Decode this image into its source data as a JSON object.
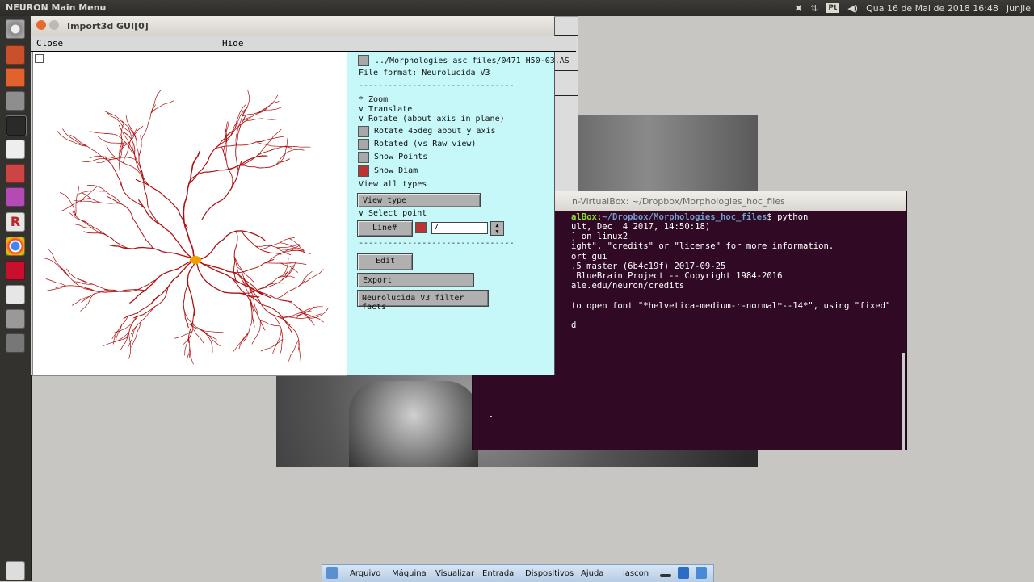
{
  "topbar": {
    "app_name": "NEURON Main Menu",
    "lang": "Pt",
    "clock": "Qua 16 de Mai de 2018 16:48",
    "user": "Junjie"
  },
  "launcher_icons": [
    "dash-icon",
    "files-icon",
    "ubuntu-software-icon",
    "settings-icon",
    "terminal-icon",
    "text-editor-icon",
    "system-monitor-icon",
    "terminal2-icon",
    "r-icon",
    "chrome-icon",
    "mendeley-icon",
    "gedit-icon",
    "disk-icon",
    "drive-icon",
    "trash-icon"
  ],
  "gui_window": {
    "title": "Import3d GUI[0]",
    "menu": {
      "close": "Close",
      "hide": "Hide"
    },
    "panel": {
      "path": "../Morphologies_asc_files/0471_H50-03.AS",
      "file_format": "File format: Neurolucida V3",
      "dashes": "--------------------------------",
      "radio_zoom": "* Zoom",
      "radio_translate": "∨ Translate",
      "radio_rotate": "∨ Rotate (about axis in plane)",
      "rotate45": "Rotate 45deg about y axis",
      "rotated_raw": "Rotated (vs Raw view)",
      "show_points": "Show Points",
      "show_diam": "Show Diam",
      "view_all_types": "View all types",
      "view_type_btn": "View type",
      "select_point": "∨ Select point",
      "line_btn": "Line#",
      "line_value": "7",
      "edit_btn": "Edit",
      "export_btn": "Export",
      "filter_btn": "Neurolucida V3 filter facts"
    }
  },
  "terminal": {
    "title": "n-VirtualBox: ~/Dropbox/Morphologies_hoc_files",
    "prompt_user": "alBox:",
    "prompt_path": "~/Dropbox/Morphologies_hoc_files",
    "prompt_cmd": "$ python",
    "lines": [
      "ult, Dec  4 2017, 14:50:18)",
      "] on linux2",
      "ight\", \"credits\" or \"license\" for more information.",
      "ort gui",
      ".5 master (6b4c19f) 2017-09-25",
      " BlueBrain Project -- Copyright 1984-2016",
      "ale.edu/neuron/credits",
      "",
      "to open font \"*helvetica-medium-r-normal*--14*\", using \"fixed\"",
      "",
      "d"
    ]
  },
  "vbox_bar": {
    "menus": [
      "Arquivo",
      "Máquina",
      "Visualizar",
      "Entrada",
      "Dispositivos",
      "Ajuda"
    ],
    "host": "lascon"
  },
  "colors": {
    "panel_bg": "#c6f8fa",
    "neuron": "#b01010",
    "soma": "#f0a000",
    "terminal_bg": "#300a24"
  }
}
